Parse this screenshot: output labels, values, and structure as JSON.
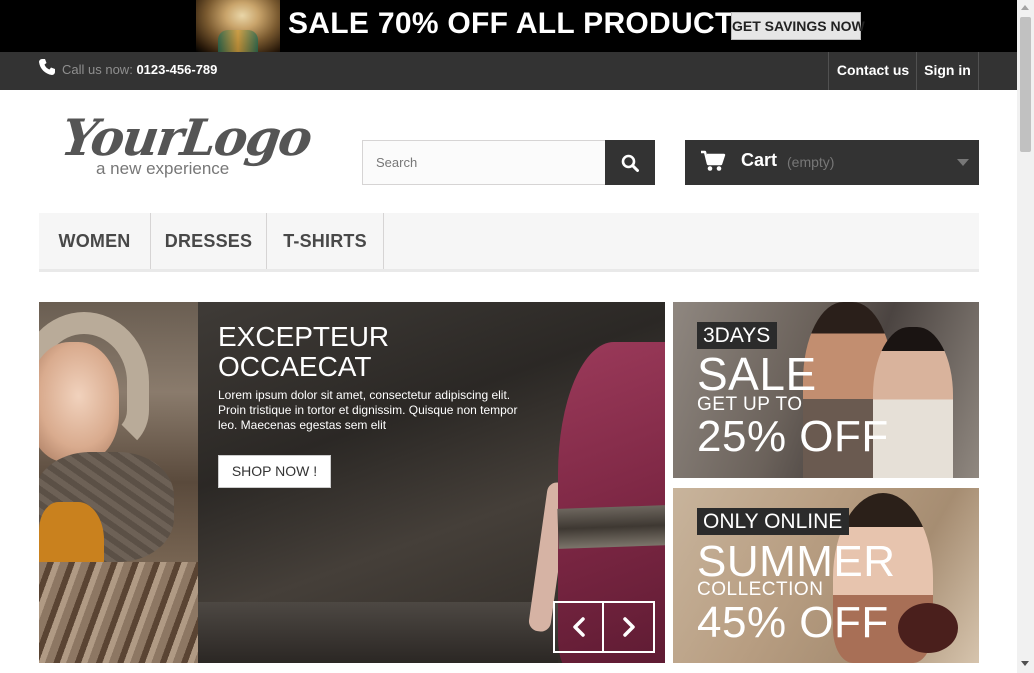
{
  "banner": {
    "text": "SALE 70% OFF ALL PRODUCTS",
    "button_label": "GET SAVINGS NOW"
  },
  "topbar": {
    "call_label": "Call us now:",
    "phone": "0123-456-789",
    "contact_label": "Contact us",
    "signin_label": "Sign in"
  },
  "logo": {
    "main": "YourLogo",
    "tagline": "a new experience"
  },
  "search": {
    "placeholder": "Search",
    "icon": "search-icon"
  },
  "cart": {
    "label": "Cart",
    "status": "(empty)",
    "icon": "cart-icon"
  },
  "nav": {
    "items": [
      {
        "label": "WOMEN"
      },
      {
        "label": "DRESSES"
      },
      {
        "label": "T-SHIRTS"
      }
    ]
  },
  "slider": {
    "title_line1": "EXCEPTEUR",
    "title_line2": "OCCAECAT",
    "text": "Lorem ipsum dolor sit amet, consectetur adipiscing elit. Proin tristique in tortor et dignissim. Quisque non tempor leo. Maecenas egestas sem elit",
    "button_label": "SHOP NOW !",
    "prev_icon": "chevron-left-icon",
    "next_icon": "chevron-right-icon"
  },
  "promo1": {
    "tag": "3DAYS",
    "headline": "SALE",
    "subline": "GET UP TO",
    "discount": "25% OFF"
  },
  "promo2": {
    "tag": "ONLY ONLINE",
    "headline": "SUMMER",
    "subline": "COLLECTION",
    "discount": "45% OFF"
  },
  "colors": {
    "topbar": "#333333",
    "accent_dark": "#333333",
    "nav_bg": "#f6f6f6"
  }
}
